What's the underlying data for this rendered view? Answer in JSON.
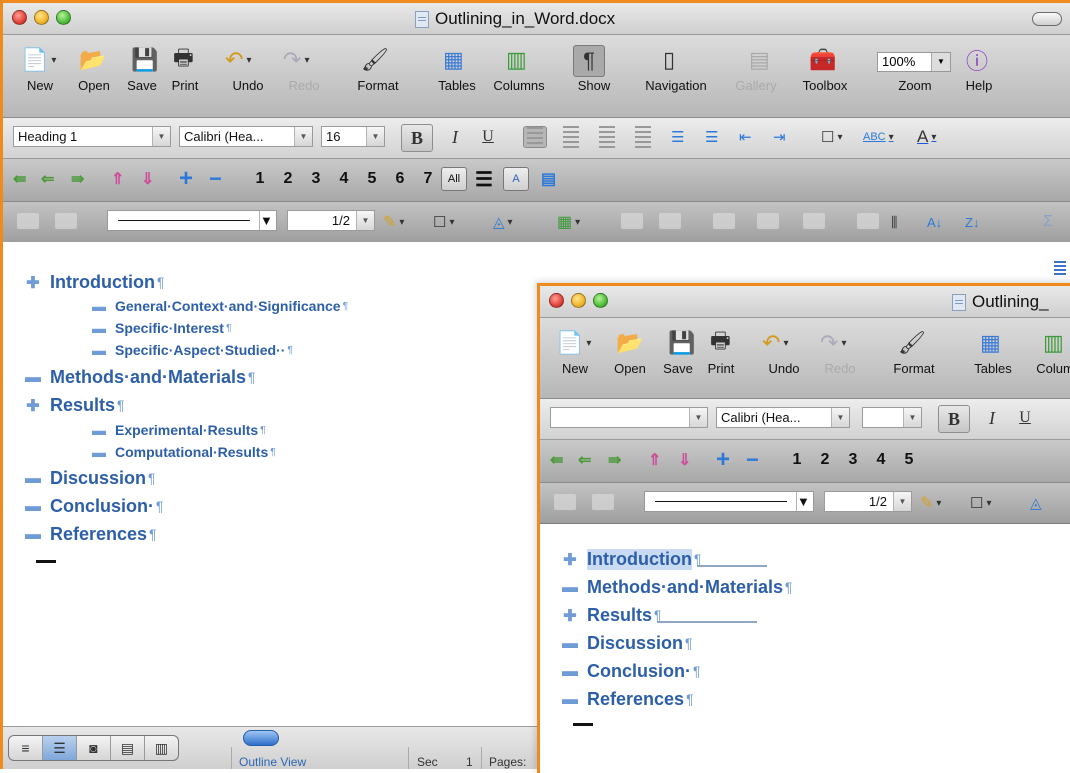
{
  "back_window": {
    "title": "Outlining_in_Word.docx",
    "toolbar": {
      "new": "New",
      "open": "Open",
      "save": "Save",
      "print": "Print",
      "undo": "Undo",
      "redo": "Redo",
      "format": "Format",
      "tables": "Tables",
      "columns": "Columns",
      "show": "Show",
      "navigation": "Navigation",
      "gallery": "Gallery",
      "toolbox": "Toolbox",
      "zoom": "Zoom",
      "help": "Help",
      "zoom_value": "100%"
    },
    "formatting": {
      "style": "Heading 1",
      "font": "Calibri (Hea...",
      "size": "16"
    },
    "outlining": {
      "levels": [
        "1",
        "2",
        "3",
        "4",
        "5",
        "6",
        "7"
      ],
      "all_label": "All"
    },
    "drawing": {
      "line_weight": "1/2"
    },
    "outline": [
      {
        "level": 1,
        "symbol": "plus",
        "text": "Introduction"
      },
      {
        "level": 2,
        "symbol": "minus",
        "text": "General·Context·and·Significance"
      },
      {
        "level": 2,
        "symbol": "minus",
        "text": "Specific·Interest"
      },
      {
        "level": 2,
        "symbol": "minus",
        "text": "Specific·Aspect·Studied··"
      },
      {
        "level": 1,
        "symbol": "minus",
        "text": "Methods·and·Materials"
      },
      {
        "level": 1,
        "symbol": "plus",
        "text": "Results"
      },
      {
        "level": 2,
        "symbol": "minus",
        "text": "Experimental·Results"
      },
      {
        "level": 2,
        "symbol": "minus",
        "text": "Computational·Results"
      },
      {
        "level": 1,
        "symbol": "minus",
        "text": "Discussion"
      },
      {
        "level": 1,
        "symbol": "minus",
        "text": "Conclusion·"
      },
      {
        "level": 1,
        "symbol": "minus",
        "text": "References"
      }
    ],
    "pilcrow": "¶",
    "statusbar": {
      "view_name": "Outline View",
      "sec_label": "Sec",
      "sec_value": "1",
      "pages_label": "Pages:"
    }
  },
  "front_window": {
    "title": "Outlining_",
    "toolbar": {
      "new": "New",
      "open": "Open",
      "save": "Save",
      "print": "Print",
      "undo": "Undo",
      "redo": "Redo",
      "format": "Format",
      "tables": "Tables",
      "columns": "Colum"
    },
    "formatting": {
      "style": "",
      "font": "Calibri (Hea...",
      "size": ""
    },
    "outlining": {
      "levels": [
        "1",
        "2",
        "3",
        "4",
        "5"
      ]
    },
    "drawing": {
      "line_weight": "1/2"
    },
    "outline": [
      {
        "symbol": "plus",
        "text": "Introduction",
        "collapsed": true,
        "selected": true
      },
      {
        "symbol": "minus",
        "text": "Methods·and·Materials",
        "collapsed": false
      },
      {
        "symbol": "plus",
        "text": "Results",
        "collapsed": true
      },
      {
        "symbol": "minus",
        "text": "Discussion",
        "collapsed": false
      },
      {
        "symbol": "minus",
        "text": "Conclusion·",
        "collapsed": false
      },
      {
        "symbol": "minus",
        "text": "References",
        "collapsed": false
      }
    ]
  },
  "colors": {
    "accent_border": "#ef8a1e",
    "heading_blue": "#2d5fa8",
    "outline_symbol": "#6f9bd6"
  }
}
